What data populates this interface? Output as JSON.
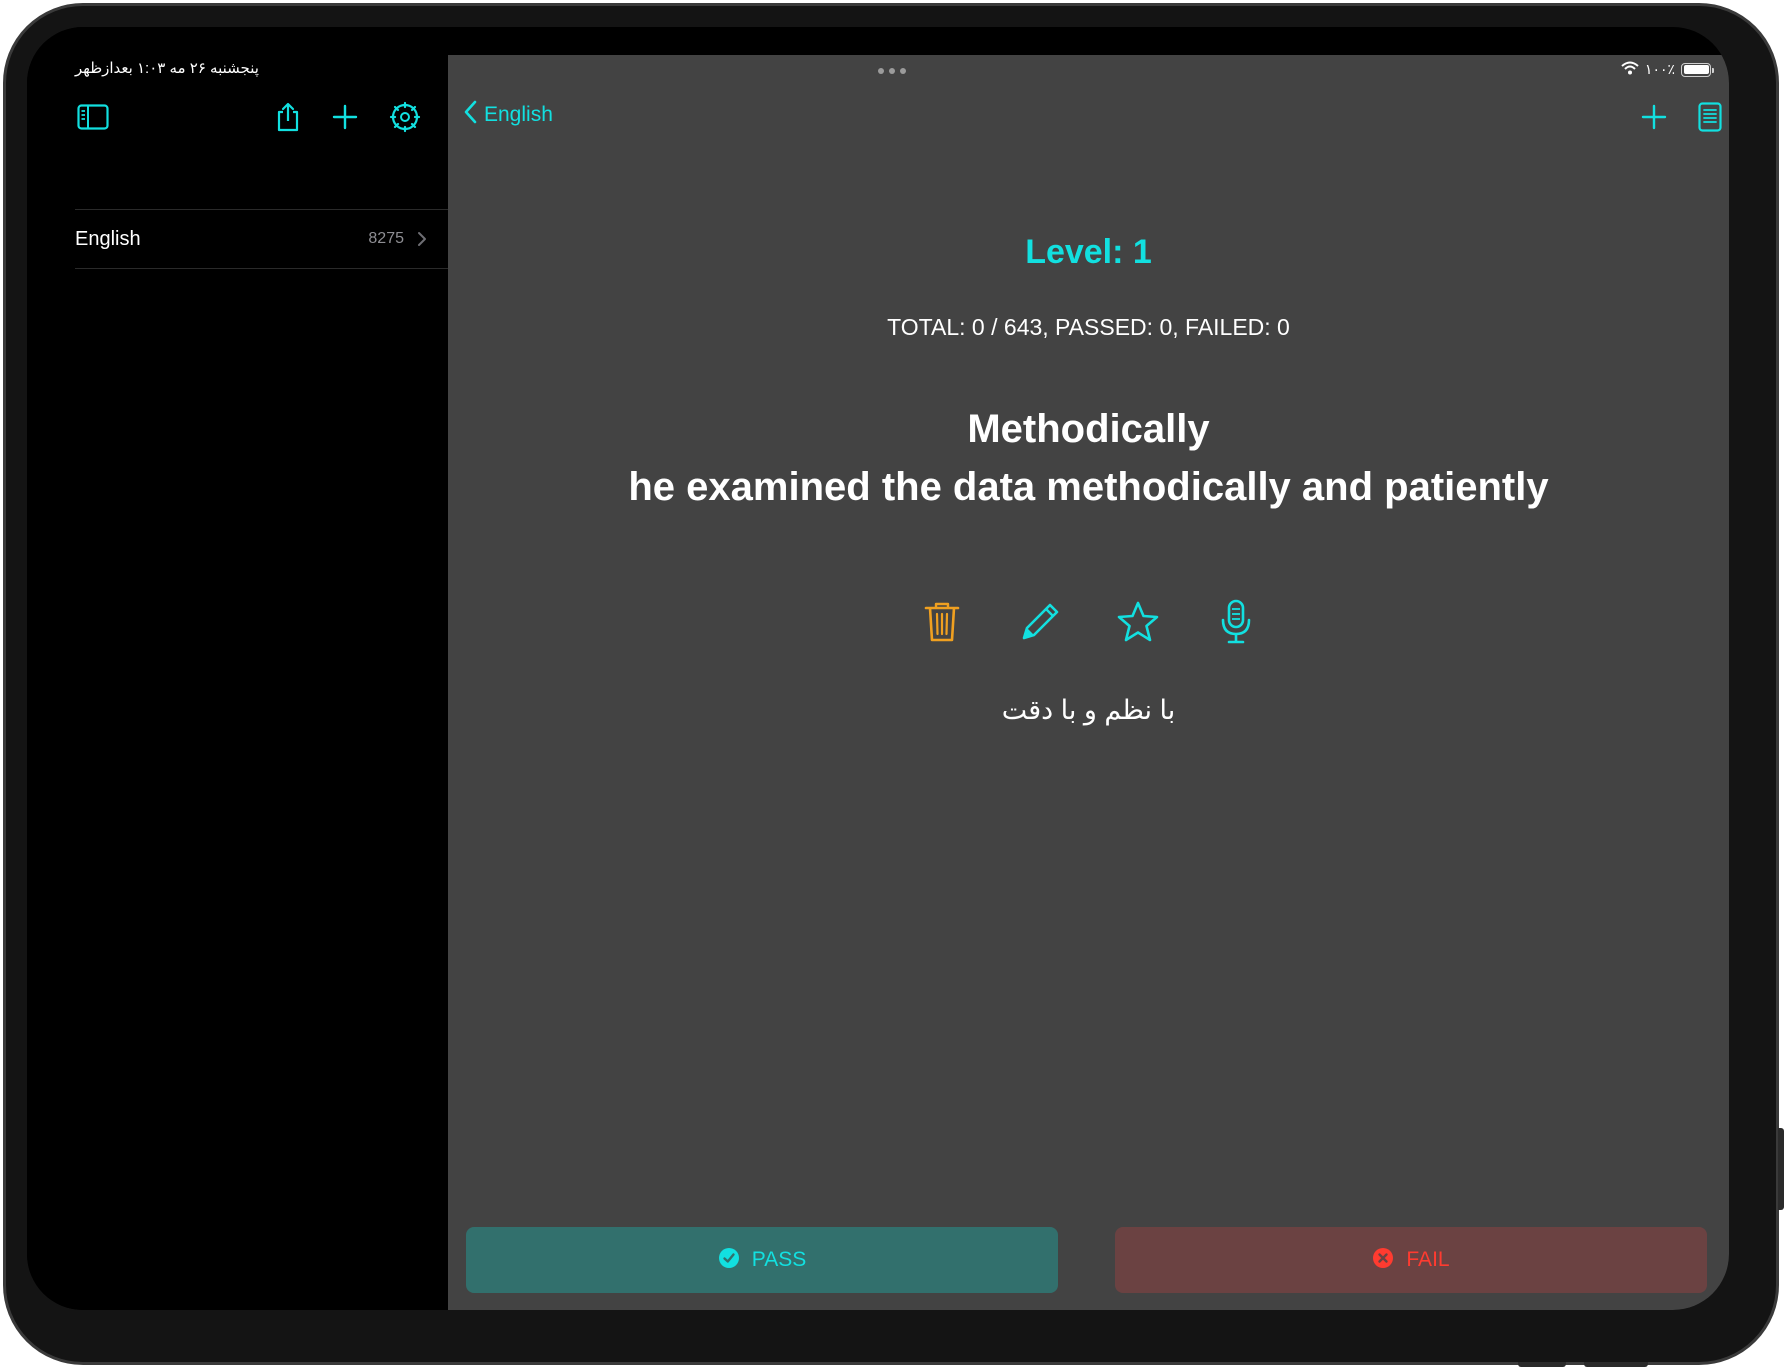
{
  "status": {
    "datetime": "پنجشنبه ۲۶ مه   ۱:۰۳ بعدازظهر",
    "battery_text": "۱۰۰٪"
  },
  "sidebar": {
    "items": [
      {
        "label": "English",
        "count": "8275"
      }
    ]
  },
  "nav": {
    "back_label": "English"
  },
  "card": {
    "level": "Level: 1",
    "stats": "TOTAL: 0 / 643, PASSED: 0, FAILED: 0",
    "word": "Methodically",
    "example": "he examined the data methodically and patiently",
    "translation": "با نظم و با دقت"
  },
  "buttons": {
    "pass_label": "PASS",
    "fail_label": "FAIL"
  },
  "colors": {
    "accent": "#12e0e0",
    "delete": "#f0a020",
    "pass_bg": "#32706d",
    "fail_bg": "#6b4242",
    "fail_text": "#ff3b30",
    "main_bg": "#434343"
  },
  "icons": {
    "sidebar_toggle": "sidebar-toggle-icon",
    "share": "share-icon",
    "add": "plus-icon",
    "settings": "gear-icon",
    "back": "chevron-left-icon",
    "list": "list-icon",
    "delete": "trash-icon",
    "edit": "pencil-icon",
    "favorite": "star-icon",
    "record": "microphone-icon",
    "pass": "checkmark-circle-icon",
    "fail": "x-circle-icon"
  }
}
